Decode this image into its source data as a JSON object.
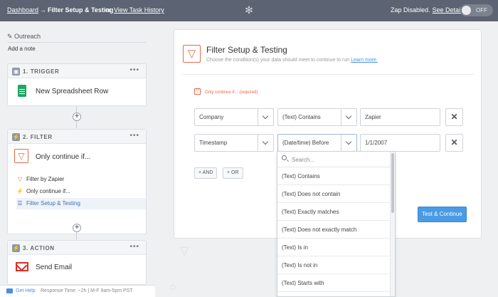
{
  "topbar": {
    "breadcrumb_dashboard": "Dashboard",
    "breadcrumb_arrow": "→",
    "breadcrumb_current": "Filter Setup & Testing",
    "breadcrumb_or": "or",
    "view_history": "View Task History",
    "zap_status": "Zap Disabled.",
    "see_details": "See Details",
    "toggle_label": "OFF"
  },
  "sidebar": {
    "zap_name": "Outreach",
    "add_note": "Add a note",
    "trigger": {
      "step_label": "1. TRIGGER",
      "app_title": "New Spreadsheet Row",
      "menu": "•••"
    },
    "filter": {
      "step_label": "2. FILTER",
      "app_title": "Only continue if...",
      "menu": "•••",
      "sub_items": [
        {
          "label": "Filter by Zapier"
        },
        {
          "label": "Only continue if..."
        },
        {
          "label": "Filter Setup & Testing"
        }
      ]
    },
    "action": {
      "step_label": "3. ACTION",
      "app_title": "Send Email",
      "menu": "•••"
    },
    "help": {
      "link": "Get Help",
      "response_time": "Response Time: ~2h | M-F 9am-5pm PST"
    }
  },
  "main": {
    "title": "Filter Setup & Testing",
    "subtitle": "Choose the condition(s) your data should meet to continue to run",
    "learn_more": "Learn more.",
    "only_continue_label": "Only continue if...",
    "required_label": "(required)",
    "rows": [
      {
        "field": "Company",
        "condition": "(Text) Contains",
        "value": "Zapier"
      },
      {
        "field": "Timestamp",
        "condition": "(Date/time) Before",
        "value": "1/1/2007"
      }
    ],
    "and_button": "+ AND",
    "or_button": "+ OR",
    "test_button": "Test & Continue"
  },
  "dropdown": {
    "search_placeholder": "Search...",
    "options": [
      "(Text) Contains",
      "(Text) Does not contain",
      "(Text) Exactly matches",
      "(Text) Does not exactly match",
      "(Text) Is in",
      "(Text) Is not in",
      "(Text) Starts with"
    ]
  },
  "colors": {
    "topbar": "#5c6473",
    "filter_accent": "#e46b47",
    "link_blue": "#4a90e2",
    "primary_button": "#4a9ae6"
  },
  "icons": {
    "gear": "gear-icon",
    "sheets": "google-sheets-icon",
    "filter": "filter-funnel-icon",
    "gmail": "gmail-icon",
    "remove": "close-icon",
    "search": "search-icon"
  }
}
